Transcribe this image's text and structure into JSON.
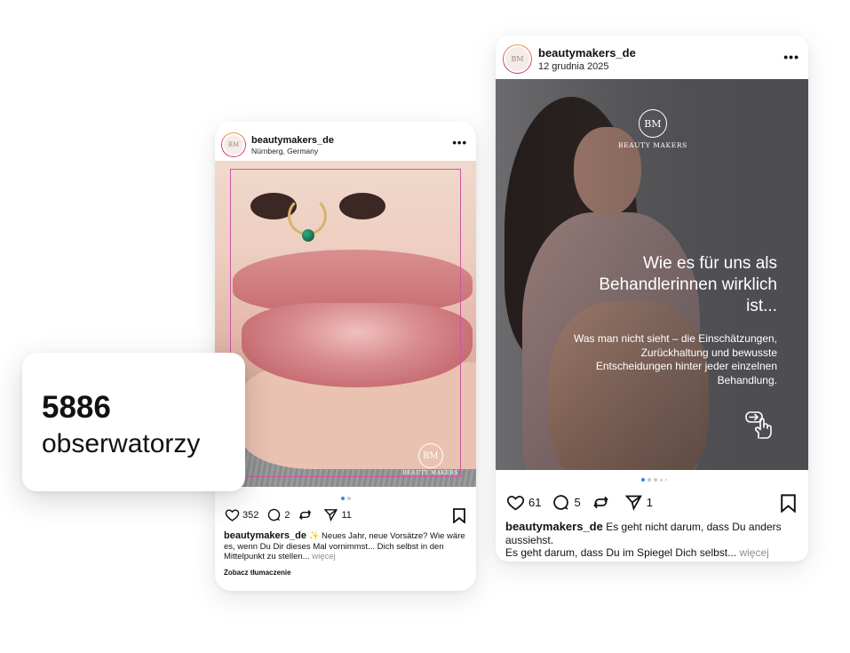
{
  "post_left": {
    "username": "beautymakers_de",
    "location": "Nürnberg, Germany",
    "avatar_text": "BM",
    "watermark_monogram": "BM",
    "watermark_brand": "BEAUTY MAKERS",
    "likes": "352",
    "comments": "2",
    "shares": "11",
    "carousel_pages": 2,
    "carousel_active": 1,
    "caption_username": "beautymakers_de",
    "caption_text": "✨ Neues Jahr, neue Vorsätze? Wie wäre es, wenn Du Dir dieses Mal vornimmst... Dich selbst in den Mittelpunkt zu stellen...",
    "more_label": "więcej",
    "translate_label": "Zobacz tłumaczenie"
  },
  "post_right": {
    "username": "beautymakers_de",
    "date": "12 grudnia 2025",
    "avatar_text": "BM",
    "logo_monogram": "BM",
    "logo_brand": "BEAUTY MAKERS",
    "overlay_title": "Wie es für uns als Behandlerinnen wirklich ist...",
    "overlay_subtitle": "Was man nicht sieht – die Einschätzungen, Zurückhaltung und bewusste Entscheidungen hinter jeder einzelnen Behandlung.",
    "likes": "61",
    "comments": "5",
    "shares": "1",
    "carousel_pages": 5,
    "carousel_active": 1,
    "caption_username": "beautymakers_de",
    "caption_line1": "Es geht nicht darum, dass Du anders aussiehst.",
    "caption_line2": "Es geht darum, dass Du im Spiegel Dich selbst...",
    "more_label": "więcej"
  },
  "follower_badge": {
    "count": "5886",
    "label": "obserwatorzy"
  },
  "icons": {
    "like": "heart-icon",
    "comment": "comment-icon",
    "repost": "repost-icon",
    "share": "send-icon",
    "save": "bookmark-icon",
    "menu": "more-icon",
    "swipe": "tap-swipe-icon"
  },
  "colors": {
    "story_ring": "#e1306c",
    "pager_active": "#3b82f6",
    "frame_line": "#cc57a8",
    "muted": "#8e8e8e"
  }
}
